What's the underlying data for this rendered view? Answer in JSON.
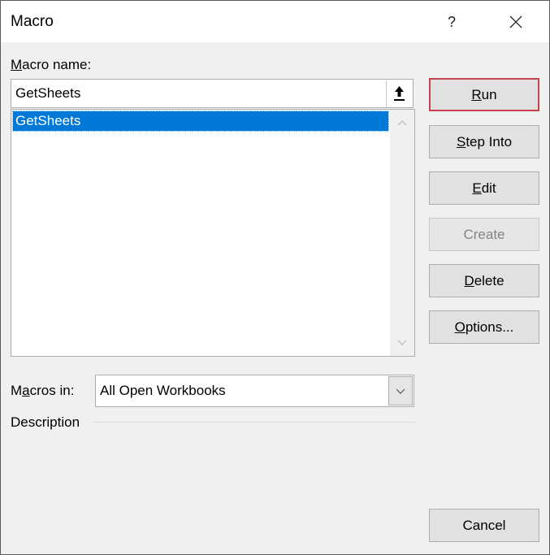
{
  "window": {
    "title": "Macro",
    "help_label": "?",
    "close_icon": "close-icon"
  },
  "macro_name": {
    "label_mnemonic": "M",
    "label_rest": "acro name:",
    "value": "GetSheets",
    "ref_icon": "collapse-arrow-icon"
  },
  "macro_list": {
    "items": [
      {
        "label": "GetSheets",
        "selected": true
      }
    ]
  },
  "buttons": [
    {
      "id": "run",
      "mnemonic": "R",
      "rest": "un",
      "default": true,
      "enabled": true
    },
    {
      "id": "step-into",
      "mnemonic": "S",
      "rest": "tep Into",
      "enabled": true
    },
    {
      "id": "edit",
      "mnemonic": "E",
      "rest": "dit",
      "enabled": true
    },
    {
      "id": "create",
      "mnemonic": "",
      "rest": "Create",
      "enabled": false
    },
    {
      "id": "delete",
      "mnemonic": "D",
      "rest": "elete",
      "enabled": true
    },
    {
      "id": "options",
      "mnemonic": "O",
      "rest": "ptions...",
      "enabled": true
    }
  ],
  "cancel_label": "Cancel",
  "macros_in": {
    "label_pre": "M",
    "label_mnemonic": "a",
    "label_rest": "cros in:",
    "selected": "All Open Workbooks"
  },
  "description": {
    "label": "Description",
    "text": ""
  },
  "colors": {
    "selection": "#0078d7",
    "default_button_border": "#c4434c",
    "dialog_bg": "#f0f0f0"
  }
}
